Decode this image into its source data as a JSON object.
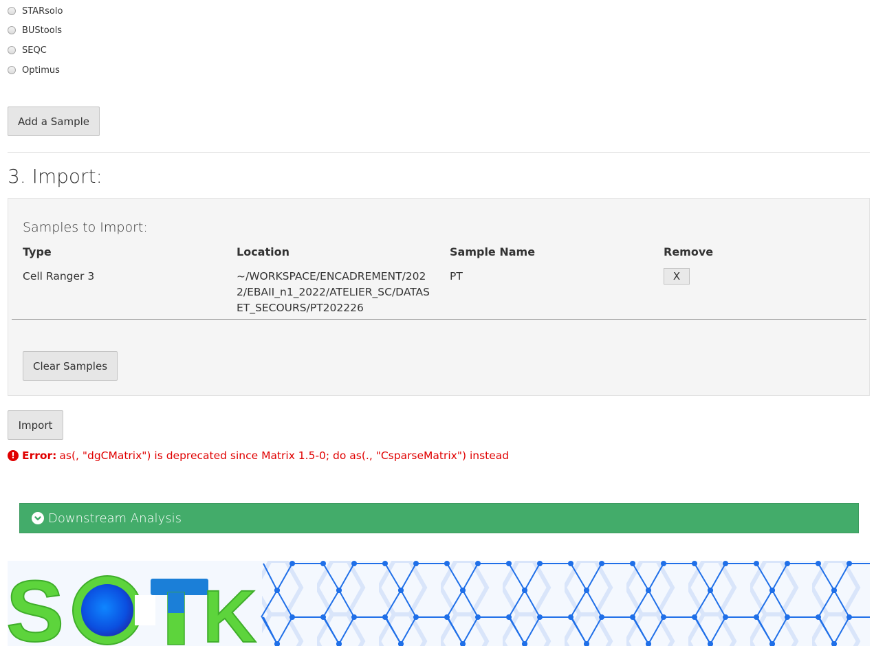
{
  "radio_options": [
    "STARsolo",
    "BUStools",
    "SEQC",
    "Optimus"
  ],
  "add_sample_label": "Add a Sample",
  "import_heading": "3. Import:",
  "samples_panel": {
    "title": "Samples to Import:",
    "columns": [
      "Type",
      "Location",
      "Sample Name",
      "Remove"
    ],
    "rows": [
      {
        "type": "Cell Ranger 3",
        "location": "~/WORKSPACE/ENCADREMENT/2022/EBAII_n1_2022/ATELIER_SC/DATASET_SECOURS/PT202226",
        "sample_name": "PT",
        "remove_label": "X"
      }
    ],
    "clear_label": "Clear Samples"
  },
  "import_label": "Import",
  "error": {
    "label": "Error:",
    "message": "as(, \"dgCMatrix\") is deprecated since Matrix 1.5-0; do as(., \"CsparseMatrix\") instead"
  },
  "downstream_label": "Downstream Analysis",
  "logo": {
    "text": "SCTK",
    "colors": {
      "s": "#5dd43c",
      "c": "#0b4fe0",
      "t": "#1b7fd8",
      "k": "#5dd43c"
    }
  },
  "colors": {
    "panel_green": "#43ac6a",
    "error_red": "#e00000",
    "network_blue": "#1f6fe8"
  }
}
